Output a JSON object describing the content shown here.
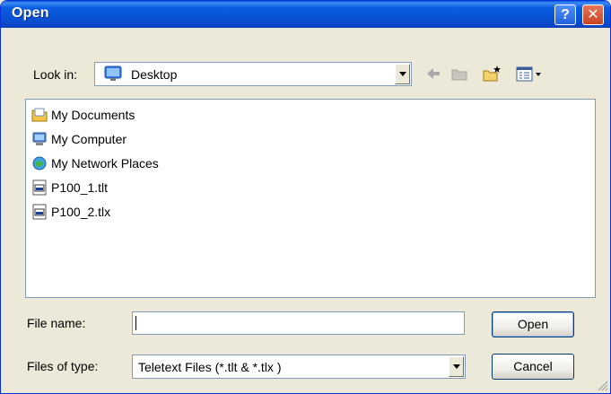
{
  "window": {
    "title": "Open"
  },
  "look_in": {
    "label": "Look in:",
    "value": "Desktop"
  },
  "files": [
    {
      "name": "My Documents",
      "icon": "my-documents-icon"
    },
    {
      "name": "My Computer",
      "icon": "my-computer-icon"
    },
    {
      "name": "My Network Places",
      "icon": "network-places-icon"
    },
    {
      "name": "P100_1.tlt",
      "icon": "teletext-file-icon"
    },
    {
      "name": "P100_2.tlx",
      "icon": "teletext-file-icon"
    }
  ],
  "file_name": {
    "label": "File name:",
    "value": ""
  },
  "file_type": {
    "label": "Files of type:",
    "value": "Teletext Files (*.tlt & *.tlx )"
  },
  "buttons": {
    "open": "Open",
    "cancel": "Cancel"
  },
  "colors": {
    "titlebar": "#0a4fd2",
    "dialog_bg": "#ece9d8",
    "close": "#c9431f"
  }
}
